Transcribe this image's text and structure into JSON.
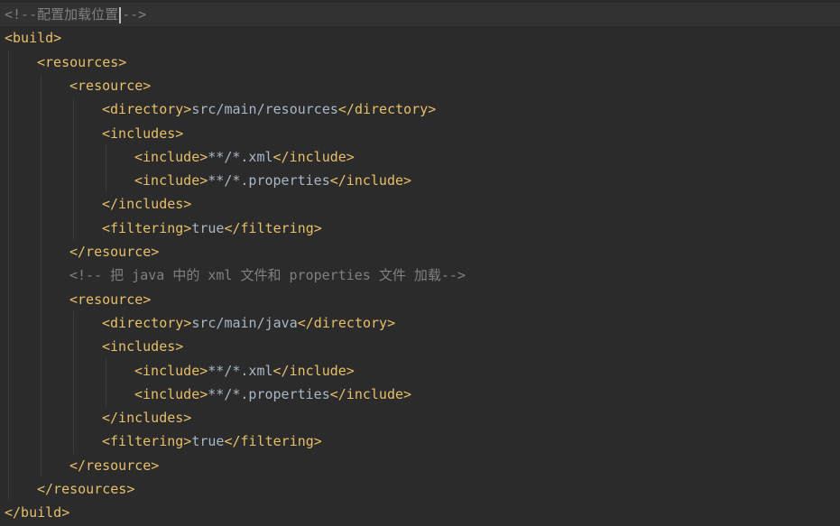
{
  "editor": {
    "lines": [
      {
        "indent": 0,
        "segments": [
          {
            "type": "comment",
            "text": "<!--配置加载位置"
          },
          {
            "type": "caret"
          },
          {
            "type": "comment",
            "text": "-->"
          }
        ],
        "current": true
      },
      {
        "indent": 0,
        "segments": [
          {
            "type": "tag",
            "text": "<build>"
          }
        ]
      },
      {
        "indent": 1,
        "segments": [
          {
            "type": "tag",
            "text": "<resources>"
          }
        ]
      },
      {
        "indent": 2,
        "segments": [
          {
            "type": "tag",
            "text": "<resource>"
          }
        ]
      },
      {
        "indent": 3,
        "segments": [
          {
            "type": "tag",
            "text": "<directory>"
          },
          {
            "type": "text",
            "text": "src/main/resources"
          },
          {
            "type": "tag",
            "text": "</directory>"
          }
        ]
      },
      {
        "indent": 3,
        "segments": [
          {
            "type": "tag",
            "text": "<includes>"
          }
        ]
      },
      {
        "indent": 4,
        "segments": [
          {
            "type": "tag",
            "text": "<include>"
          },
          {
            "type": "text",
            "text": "**/*.xml"
          },
          {
            "type": "tag",
            "text": "</include>"
          }
        ]
      },
      {
        "indent": 4,
        "segments": [
          {
            "type": "tag",
            "text": "<include>"
          },
          {
            "type": "text",
            "text": "**/*.properties"
          },
          {
            "type": "tag",
            "text": "</include>"
          }
        ]
      },
      {
        "indent": 3,
        "segments": [
          {
            "type": "tag",
            "text": "</includes>"
          }
        ]
      },
      {
        "indent": 3,
        "segments": [
          {
            "type": "tag",
            "text": "<filtering>"
          },
          {
            "type": "text",
            "text": "true"
          },
          {
            "type": "tag",
            "text": "</filtering>"
          }
        ]
      },
      {
        "indent": 2,
        "segments": [
          {
            "type": "tag",
            "text": "</resource>"
          }
        ]
      },
      {
        "indent": 2,
        "segments": [
          {
            "type": "comment",
            "text": "<!-- 把 java 中的 xml 文件和 properties 文件 加载-->"
          }
        ]
      },
      {
        "indent": 2,
        "segments": [
          {
            "type": "tag",
            "text": "<resource>"
          }
        ]
      },
      {
        "indent": 3,
        "segments": [
          {
            "type": "tag",
            "text": "<directory>"
          },
          {
            "type": "text",
            "text": "src/main/java"
          },
          {
            "type": "tag",
            "text": "</directory>"
          }
        ]
      },
      {
        "indent": 3,
        "segments": [
          {
            "type": "tag",
            "text": "<includes>"
          }
        ]
      },
      {
        "indent": 4,
        "segments": [
          {
            "type": "tag",
            "text": "<include>"
          },
          {
            "type": "text",
            "text": "**/*.xml"
          },
          {
            "type": "tag",
            "text": "</include>"
          }
        ]
      },
      {
        "indent": 4,
        "segments": [
          {
            "type": "tag",
            "text": "<include>"
          },
          {
            "type": "text",
            "text": "**/*.properties"
          },
          {
            "type": "tag",
            "text": "</include>"
          }
        ]
      },
      {
        "indent": 3,
        "segments": [
          {
            "type": "tag",
            "text": "</includes>"
          }
        ]
      },
      {
        "indent": 3,
        "segments": [
          {
            "type": "tag",
            "text": "<filtering>"
          },
          {
            "type": "text",
            "text": "true"
          },
          {
            "type": "tag",
            "text": "</filtering>"
          }
        ]
      },
      {
        "indent": 2,
        "segments": [
          {
            "type": "tag",
            "text": "</resource>"
          }
        ]
      },
      {
        "indent": 1,
        "segments": [
          {
            "type": "tag",
            "text": "</resources>"
          }
        ]
      },
      {
        "indent": 0,
        "segments": [
          {
            "type": "tag",
            "text": "</build>"
          }
        ]
      }
    ]
  },
  "colors": {
    "background": "#2b2b2b",
    "current_line": "#323232",
    "tag": "#e8bf6a",
    "text": "#a9b7c6",
    "comment": "#808080"
  }
}
